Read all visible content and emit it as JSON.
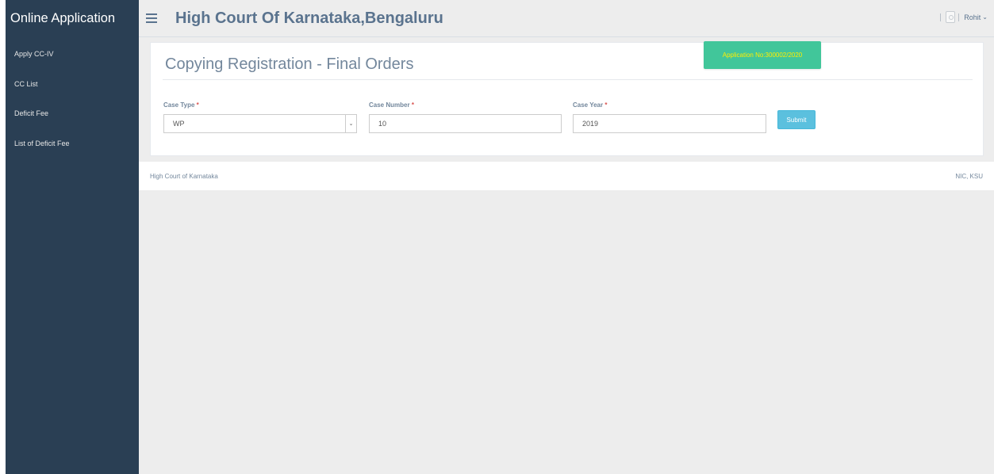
{
  "sidebar": {
    "brand": "Online Application",
    "items": [
      {
        "label": "Apply CC-IV"
      },
      {
        "label": "CC List"
      },
      {
        "label": "Deficit Fee"
      },
      {
        "label": "List of Deficit Fee"
      }
    ]
  },
  "header": {
    "title": "High Court Of Karnataka,Bengaluru",
    "user_name": "Rohit"
  },
  "panel": {
    "title": "Copying Registration - Final Orders",
    "application_badge": "Application No:300002/2020"
  },
  "form": {
    "case_type": {
      "label": "Case Type",
      "required_mark": "*",
      "value": "WP"
    },
    "case_number": {
      "label": "Case Number",
      "required_mark": "*",
      "value": "10"
    },
    "case_year": {
      "label": "Case Year",
      "required_mark": "*",
      "value": "2019"
    },
    "submit_label": "Submit"
  },
  "footer": {
    "left": "High Court of Karnataka",
    "right": "NIC, KSU"
  },
  "colors": {
    "sidebar": "#2a3f54",
    "badge": "#41c69a",
    "badge_text": "#ffee00",
    "submit": "#5bc0de"
  }
}
